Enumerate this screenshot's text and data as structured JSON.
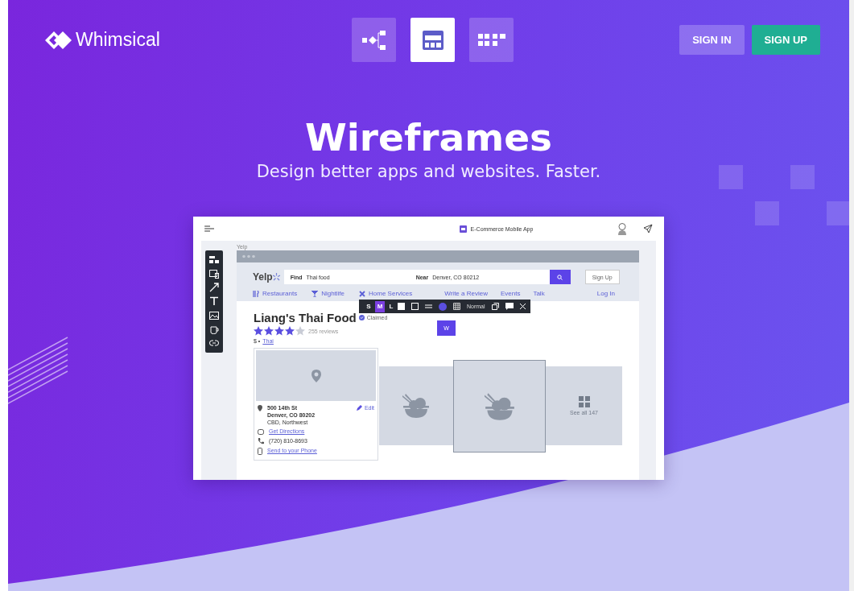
{
  "header": {
    "logo": "Whimsical",
    "products": [
      {
        "kind": "flowchart",
        "selected": false
      },
      {
        "kind": "wireframe",
        "selected": true
      },
      {
        "kind": "board",
        "selected": false
      }
    ],
    "buttons": [
      {
        "label": "SIGN IN",
        "kind": "secondary"
      },
      {
        "label": "SIGN UP",
        "kind": "primary"
      }
    ]
  },
  "hero": {
    "title": "Wireframes",
    "subtitle": "Design better apps and websites. Faster."
  },
  "app": {
    "doc_title": "E-Commerce Mobile App",
    "tools": [
      {
        "kind": "elements"
      },
      {
        "kind": "device"
      },
      {
        "kind": "arrow"
      },
      {
        "kind": "text"
      },
      {
        "kind": "image"
      },
      {
        "kind": "icon"
      },
      {
        "kind": "link"
      }
    ],
    "frame_label": "Yelp",
    "site": {
      "logo": "Yelp",
      "find_label": "Find",
      "find_value": "Thai food",
      "near_label": "Near",
      "near_value": "Denver, CO 80212",
      "signup": "Sign Up",
      "nav": [
        {
          "label": "Restaurants",
          "kind": "restaurants"
        },
        {
          "label": "Nightlife",
          "kind": "nightlife"
        },
        {
          "label": "Home Services",
          "kind": "services"
        }
      ],
      "links": [
        "Write a Review",
        "Events",
        "Talk"
      ],
      "login": "Log In",
      "business": "Liang's Thai Food",
      "claimed": "Claimed",
      "stars": 4,
      "reviews": "255 reviews",
      "price": "$ •",
      "category": "Thai",
      "address": [
        "500 14th St",
        "Denver, CO 80202",
        "CBD, Northwest"
      ],
      "edit": "Edit",
      "directions": "Get Directions",
      "phone": "(720) 810-8693",
      "send": "Send to your Phone",
      "see_all": "See all 147"
    },
    "format_toolbar": {
      "sizes": [
        {
          "label": "S",
          "selected": false
        },
        {
          "label": "M",
          "selected": true
        },
        {
          "label": "L",
          "selected": false
        }
      ],
      "style_label": "Normal"
    },
    "text_chip": "W"
  }
}
